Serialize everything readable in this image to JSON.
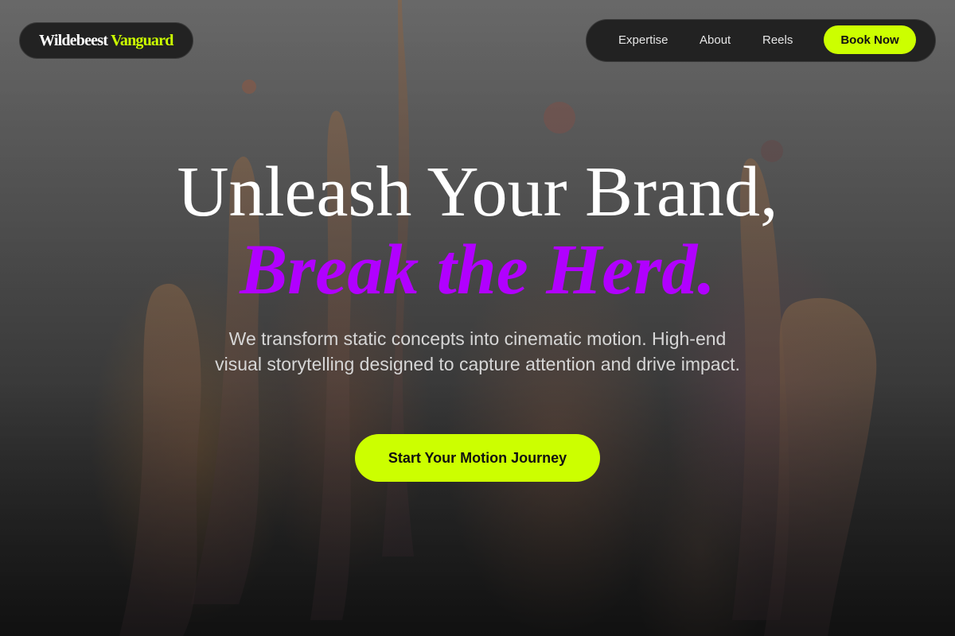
{
  "brand": {
    "name_part1": "Wildebeest",
    "name_part2": "Vanguard"
  },
  "nav": {
    "links": [
      "Expertise",
      "About",
      "Reels"
    ],
    "cta_label": "Book Now"
  },
  "hero": {
    "headline_line1": "Unleash Your Brand,",
    "headline_line2": "Break the Herd.",
    "subtext": "We transform static concepts into cinematic motion. High-end visual storytelling designed to capture attention and drive impact.",
    "cta_label": "Start Your Motion Journey"
  },
  "colors": {
    "accent": "#ccff00",
    "headline_accent": "#b100ff",
    "nav_bg": "#222222"
  }
}
